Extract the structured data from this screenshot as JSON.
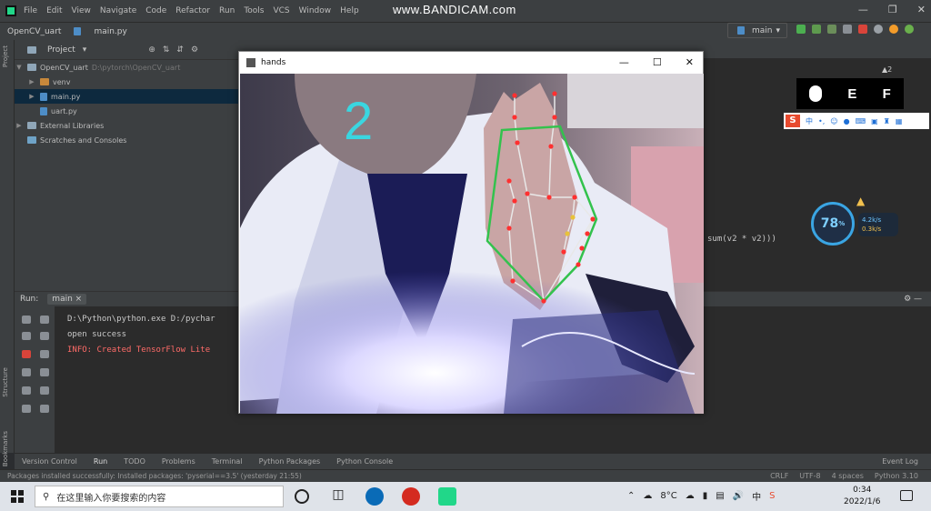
{
  "recorder": {
    "watermark": "www.BANDICAM.com"
  },
  "ide": {
    "menu": [
      "File",
      "Edit",
      "View",
      "Navigate",
      "Code",
      "Refactor",
      "Run",
      "Tools",
      "VCS",
      "Window",
      "Help"
    ],
    "breadcrumb": {
      "project": "OpenCV_uart",
      "file": "main.py"
    },
    "run_config": "main",
    "project_panel": {
      "title": "Project",
      "root": {
        "name": "OpenCV_uart",
        "path": "D:\\pytorch\\OpenCV_uart"
      },
      "items": [
        {
          "name": "venv",
          "type": "folder"
        },
        {
          "name": "main.py",
          "type": "file"
        },
        {
          "name": "uart.py",
          "type": "file"
        }
      ],
      "external": "External Libraries",
      "scratches": "Scratches and Consoles"
    },
    "editor": {
      "code_fragment": "sum(v2 * v2)))",
      "warning_count": "▲2"
    },
    "run_panel": {
      "label": "Run:",
      "tab": "main",
      "console": [
        "D:\\Python\\python.exe D:/pychar",
        "open success",
        "INFO: Created TensorFlow Lite"
      ]
    },
    "tool_tabs": [
      "Version Control",
      "Run",
      "TODO",
      "Problems",
      "Terminal",
      "Python Packages",
      "Python Console"
    ],
    "event_log": "Event Log",
    "status": {
      "message": "Packages installed successfully: Installed packages: 'pyserial==3.5' (yesterday 21:55)",
      "line_sep": "CRLF",
      "encoding": "UTF-8",
      "indent": "4 spaces",
      "interpreter": "Python 3.10"
    }
  },
  "hands_window": {
    "title": "hands",
    "finger_count": "2",
    "landmark_color": "#ff3030",
    "connection_color": "#e8e8e8",
    "hull_color": "#33c24d",
    "count_color": "#3ad6e0"
  },
  "overlay": {
    "keys": [
      "E",
      "F"
    ],
    "ime": {
      "logo": "S",
      "lang": "中"
    },
    "perf": {
      "percent": "78",
      "unit": "%",
      "up": "4.2k/s",
      "down": "0.3k/s"
    }
  },
  "taskbar": {
    "search_placeholder": "在这里输入你要搜索的内容",
    "weather": "8°C",
    "time": "0:34",
    "date": "2022/1/6"
  }
}
